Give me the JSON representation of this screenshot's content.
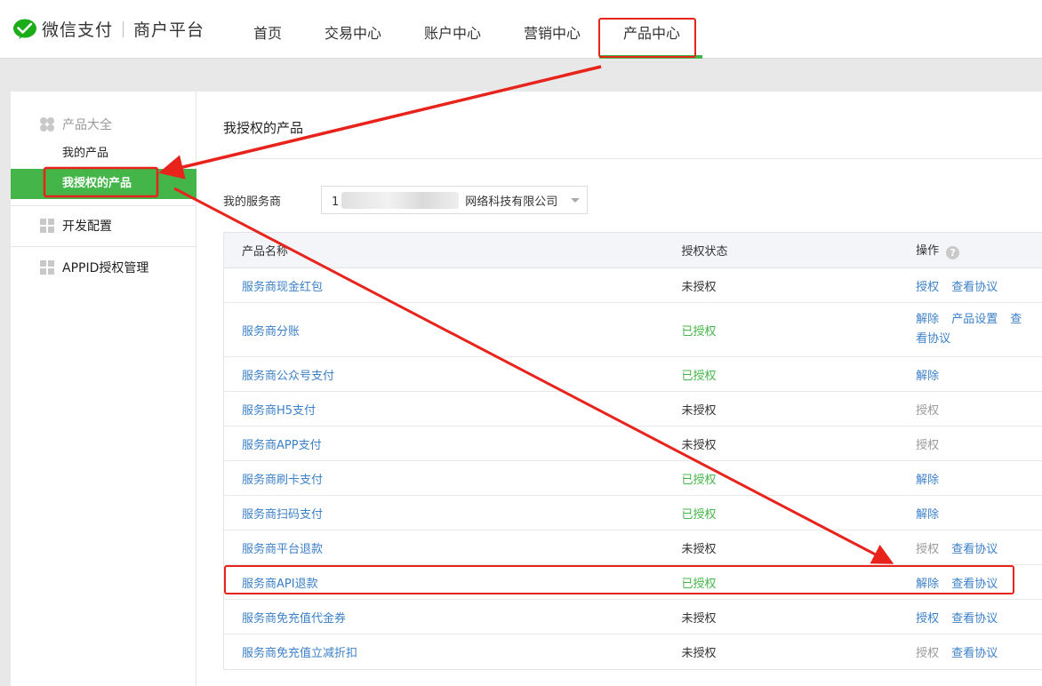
{
  "header": {
    "brand": "微信支付",
    "platform": "商户平台",
    "nav": [
      {
        "label": "首页"
      },
      {
        "label": "交易中心"
      },
      {
        "label": "账户中心"
      },
      {
        "label": "营销中心"
      },
      {
        "label": "产品中心"
      }
    ]
  },
  "sidebar": {
    "section_products": "产品大全",
    "my_products": "我的产品",
    "authorized_products": "我授权的产品",
    "dev_config": "开发配置",
    "appid_manage": "APPID授权管理"
  },
  "main": {
    "title": "我授权的产品",
    "filter_label": "我的服务商",
    "filter_value_prefix": "1",
    "filter_value_suffix": "网络科技有限公司",
    "table": {
      "headers": {
        "name": "产品名称",
        "status": "授权状态",
        "ops": "操作"
      },
      "help": "?",
      "rows": [
        {
          "name": "服务商现金红包",
          "status": "未授权",
          "op1": "授权",
          "op2": "查看协议",
          "op3": ""
        },
        {
          "name": "服务商分账",
          "status": "已授权",
          "op1": "解除",
          "op2": "产品设置",
          "op3": "查",
          "op4": "看协议"
        },
        {
          "name": "服务商公众号支付",
          "status": "已授权",
          "op1": "解除",
          "op2": "",
          "op3": ""
        },
        {
          "name": "服务商H5支付",
          "status": "未授权",
          "op1": "授权",
          "op2": "",
          "op3": ""
        },
        {
          "name": "服务商APP支付",
          "status": "未授权",
          "op1": "授权",
          "op2": "",
          "op3": ""
        },
        {
          "name": "服务商刷卡支付",
          "status": "已授权",
          "op1": "解除",
          "op2": "",
          "op3": ""
        },
        {
          "name": "服务商扫码支付",
          "status": "已授权",
          "op1": "解除",
          "op2": "",
          "op3": ""
        },
        {
          "name": "服务商平台退款",
          "status": "未授权",
          "op1": "授权",
          "op2": "查看协议",
          "op3": ""
        },
        {
          "name": "服务商API退款",
          "status": "已授权",
          "op1": "解除",
          "op2": "查看协议",
          "op3": ""
        },
        {
          "name": "服务商免充值代金券",
          "status": "未授权",
          "op1": "授权",
          "op2": "查看协议",
          "op3": ""
        },
        {
          "name": "服务商免充值立减折扣",
          "status": "未授权",
          "op1": "授权",
          "op2": "查看协议",
          "op3": ""
        }
      ]
    }
  },
  "colors": {
    "brand_green": "#44b549",
    "link_blue": "#3c80c8",
    "annotation_red": "#e8231c"
  }
}
